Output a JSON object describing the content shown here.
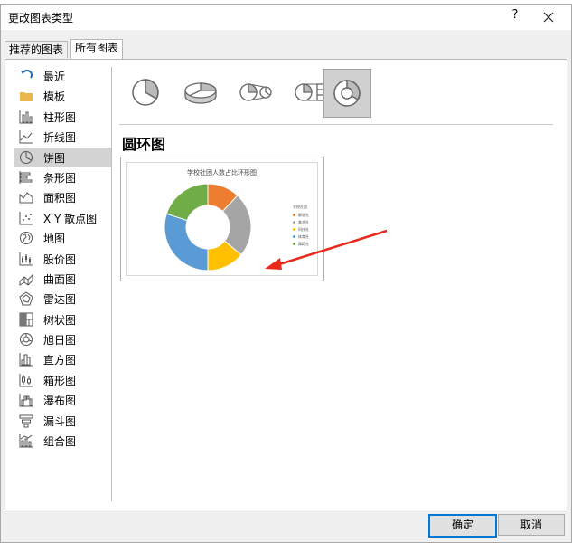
{
  "dialog": {
    "title": "更改图表类型",
    "help_label": "?"
  },
  "tabs": [
    {
      "label": "推荐的图表",
      "active": false
    },
    {
      "label": "所有图表",
      "active": true
    }
  ],
  "sidebar": {
    "items": [
      {
        "label": "最近",
        "icon": "recent-icon"
      },
      {
        "label": "模板",
        "icon": "folder-icon"
      },
      {
        "label": "柱形图",
        "icon": "column-chart-icon"
      },
      {
        "label": "折线图",
        "icon": "line-chart-icon"
      },
      {
        "label": "饼图",
        "icon": "pie-chart-icon",
        "selected": true
      },
      {
        "label": "条形图",
        "icon": "bar-chart-icon"
      },
      {
        "label": "面积图",
        "icon": "area-chart-icon"
      },
      {
        "label": "X Y 散点图",
        "icon": "scatter-chart-icon"
      },
      {
        "label": "地图",
        "icon": "map-chart-icon"
      },
      {
        "label": "股价图",
        "icon": "stock-chart-icon"
      },
      {
        "label": "曲面图",
        "icon": "surface-chart-icon"
      },
      {
        "label": "雷达图",
        "icon": "radar-chart-icon"
      },
      {
        "label": "树状图",
        "icon": "treemap-chart-icon"
      },
      {
        "label": "旭日图",
        "icon": "sunburst-chart-icon"
      },
      {
        "label": "直方图",
        "icon": "histogram-chart-icon"
      },
      {
        "label": "箱形图",
        "icon": "box-whisker-chart-icon"
      },
      {
        "label": "瀑布图",
        "icon": "waterfall-chart-icon"
      },
      {
        "label": "漏斗图",
        "icon": "funnel-chart-icon"
      },
      {
        "label": "组合图",
        "icon": "combo-chart-icon"
      }
    ]
  },
  "subtypes": [
    {
      "icon": "pie-subtype-icon",
      "selected": false
    },
    {
      "icon": "3d-pie-subtype-icon",
      "selected": false
    },
    {
      "icon": "pie-of-pie-subtype-icon",
      "selected": false
    },
    {
      "icon": "bar-of-pie-subtype-icon",
      "selected": false
    },
    {
      "icon": "doughnut-subtype-icon",
      "selected": true
    }
  ],
  "main": {
    "heading": "圆环图"
  },
  "preview": {
    "chart_title": "学校社团人数占比环形图",
    "legend_title": "学校社团",
    "legend": [
      {
        "label": "解说社",
        "color": "#ed7d31"
      },
      {
        "label": "美术社",
        "color": "#a5a5a5"
      },
      {
        "label": "科技社",
        "color": "#ffc000"
      },
      {
        "label": "体育社",
        "color": "#5b9bd5"
      },
      {
        "label": "舞蹈社",
        "color": "#70ad47"
      }
    ]
  },
  "chart_data": {
    "type": "pie",
    "subtype": "doughnut",
    "title": "学校社团人数占比环形图",
    "categories": [
      "解说社",
      "美术社",
      "科技社",
      "体育社",
      "舞蹈社"
    ],
    "values": [
      12,
      24,
      14,
      30,
      20
    ],
    "colors": [
      "#ed7d31",
      "#a5a5a5",
      "#ffc000",
      "#5b9bd5",
      "#70ad47"
    ],
    "legend_title": "学校社团",
    "legend_position": "right"
  },
  "annotation": {
    "arrow_color": "#e8291c"
  },
  "buttons": {
    "ok_label": "确定",
    "cancel_label": "取消"
  }
}
